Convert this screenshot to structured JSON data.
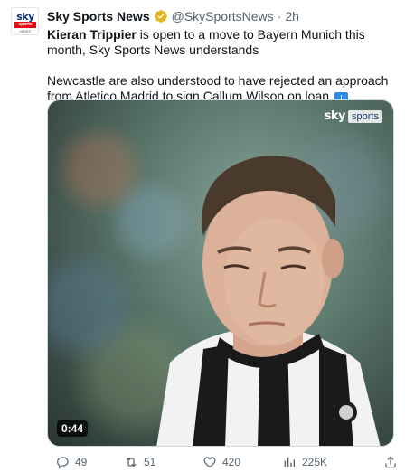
{
  "author": {
    "display_name": "Sky Sports News",
    "handle": "@SkySportsNews",
    "separator": "·",
    "time": "2h",
    "avatar_text": {
      "top": "sky",
      "middle": "sports",
      "bottom": "NEWS"
    },
    "verified_color": "#e2b719"
  },
  "tweet": {
    "p1_bold": "Kieran Trippier",
    "p1_rest": " is open to a move to Bayern Munich this month, Sky Sports News understands",
    "p1_emoji": "germany-flag",
    "p2_text": "Newcastle are also understood to have rejected an approach from Atletico Madrid to sign Callum Wilson on loan",
    "p2_emoji": "down-arrow"
  },
  "media": {
    "type": "video",
    "duration": "0:44",
    "watermark_sky": "sky",
    "watermark_sports": "sports"
  },
  "actions": {
    "replies": "49",
    "retweets": "51",
    "likes": "420",
    "views": "225K"
  },
  "colors": {
    "text": "#0f1419",
    "secondary": "#536471",
    "sky_red": "#e10a14",
    "flag": [
      "#000000",
      "#dd0000",
      "#ffce00"
    ]
  }
}
